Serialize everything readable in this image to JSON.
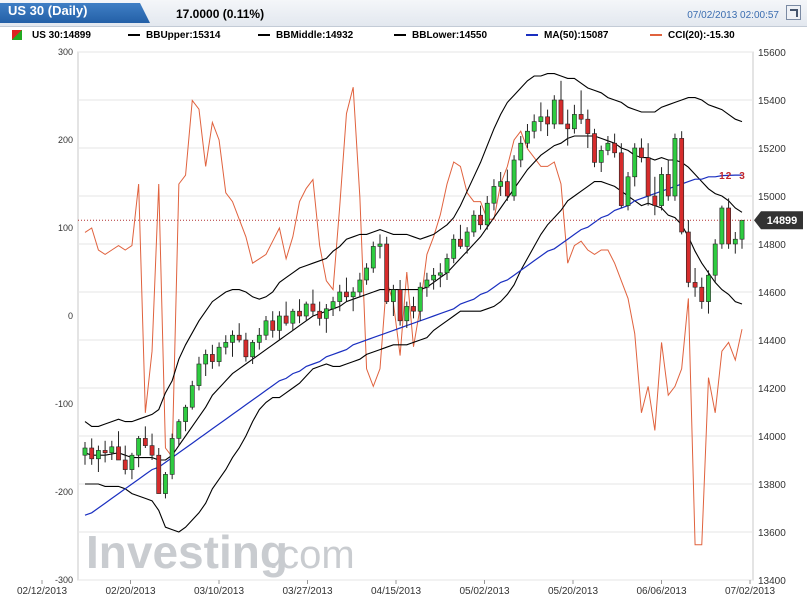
{
  "header": {
    "title": "US 30 (Daily)",
    "change": "17.0000 (0.11%)",
    "timestamp": "07/02/2013 02:00:57"
  },
  "legend": {
    "symbol": "US 30:14899",
    "bb_upper": "BBUpper:15314",
    "bb_middle": "BBMiddle:14932",
    "bb_lower": "BBLower:14550",
    "ma": "MA(50):15087",
    "cci": "CCI(20):-15.30"
  },
  "colors": {
    "up": "#2ecc40",
    "down": "#d62c2c",
    "bands": "#000000",
    "ma": "#1a2fc0",
    "cci": "#e0623e",
    "grid": "#e6e6e6"
  },
  "watermark": {
    "brand": "Investing",
    "suffix": ".com"
  },
  "chart_data": {
    "type": "candlestick",
    "price_axis": {
      "ticks": [
        13400,
        13600,
        13800,
        14000,
        14200,
        14400,
        14600,
        14800,
        15000,
        15200,
        15400,
        15600
      ],
      "ylim": [
        13400,
        15600
      ]
    },
    "cci_axis": {
      "ticks": [
        -300,
        -200,
        -100,
        0,
        100,
        200,
        300
      ],
      "ylim": [
        -300,
        300
      ]
    },
    "x_ticks": [
      "02/12/2013",
      "02/20/2013",
      "03/10/2013",
      "03/27/2013",
      "04/15/2013",
      "05/02/2013",
      "05/20/2013",
      "06/06/2013",
      "07/02/2013"
    ],
    "last_price": 14899,
    "markers": [
      "1",
      "2",
      "3"
    ],
    "candles": [
      [
        13920,
        13975,
        13880,
        13950
      ],
      [
        13950,
        13990,
        13880,
        13905
      ],
      [
        13905,
        13960,
        13850,
        13940
      ],
      [
        13940,
        13980,
        13890,
        13930
      ],
      [
        13930,
        13980,
        13900,
        13955
      ],
      [
        13955,
        14020,
        13900,
        13900
      ],
      [
        13900,
        13960,
        13840,
        13860
      ],
      [
        13860,
        13930,
        13820,
        13920
      ],
      [
        13920,
        14000,
        13870,
        13990
      ],
      [
        13990,
        14040,
        13950,
        13960
      ],
      [
        13960,
        14010,
        13900,
        13920
      ],
      [
        13920,
        13950,
        13760,
        13760
      ],
      [
        13760,
        13850,
        13740,
        13840
      ],
      [
        13840,
        14010,
        13820,
        13990
      ],
      [
        13990,
        14070,
        13960,
        14060
      ],
      [
        14060,
        14130,
        14020,
        14120
      ],
      [
        14120,
        14230,
        14110,
        14210
      ],
      [
        14210,
        14330,
        14190,
        14300
      ],
      [
        14300,
        14360,
        14250,
        14340
      ],
      [
        14340,
        14380,
        14280,
        14310
      ],
      [
        14310,
        14390,
        14290,
        14370
      ],
      [
        14370,
        14420,
        14340,
        14390
      ],
      [
        14390,
        14440,
        14330,
        14420
      ],
      [
        14420,
        14470,
        14390,
        14400
      ],
      [
        14400,
        14430,
        14310,
        14330
      ],
      [
        14330,
        14400,
        14300,
        14390
      ],
      [
        14390,
        14450,
        14360,
        14420
      ],
      [
        14420,
        14500,
        14400,
        14480
      ],
      [
        14480,
        14520,
        14410,
        14440
      ],
      [
        14440,
        14520,
        14400,
        14500
      ],
      [
        14500,
        14560,
        14460,
        14470
      ],
      [
        14470,
        14530,
        14440,
        14520
      ],
      [
        14520,
        14570,
        14470,
        14500
      ],
      [
        14500,
        14560,
        14480,
        14550
      ],
      [
        14550,
        14610,
        14500,
        14520
      ],
      [
        14520,
        14560,
        14460,
        14490
      ],
      [
        14490,
        14550,
        14430,
        14530
      ],
      [
        14530,
        14580,
        14500,
        14560
      ],
      [
        14560,
        14630,
        14520,
        14600
      ],
      [
        14600,
        14660,
        14560,
        14580
      ],
      [
        14580,
        14620,
        14520,
        14600
      ],
      [
        14600,
        14680,
        14580,
        14650
      ],
      [
        14650,
        14720,
        14630,
        14700
      ],
      [
        14700,
        14810,
        14680,
        14790
      ],
      [
        14790,
        14840,
        14740,
        14800
      ],
      [
        14800,
        14830,
        14550,
        14560
      ],
      [
        14560,
        14630,
        14500,
        14610
      ],
      [
        14610,
        14650,
        14460,
        14480
      ],
      [
        14480,
        14560,
        14450,
        14540
      ],
      [
        14540,
        14580,
        14490,
        14520
      ],
      [
        14520,
        14640,
        14480,
        14620
      ],
      [
        14620,
        14680,
        14580,
        14650
      ],
      [
        14650,
        14700,
        14610,
        14670
      ],
      [
        14670,
        14720,
        14620,
        14680
      ],
      [
        14680,
        14760,
        14650,
        14740
      ],
      [
        14740,
        14840,
        14720,
        14820
      ],
      [
        14820,
        14880,
        14780,
        14790
      ],
      [
        14790,
        14870,
        14760,
        14850
      ],
      [
        14850,
        14940,
        14830,
        14920
      ],
      [
        14920,
        14960,
        14860,
        14880
      ],
      [
        14880,
        15000,
        14860,
        14970
      ],
      [
        14970,
        15070,
        14940,
        15040
      ],
      [
        15040,
        15100,
        15000,
        15060
      ],
      [
        15060,
        15110,
        14980,
        15000
      ],
      [
        15000,
        15170,
        14980,
        15150
      ],
      [
        15150,
        15250,
        15120,
        15220
      ],
      [
        15220,
        15300,
        15200,
        15270
      ],
      [
        15270,
        15340,
        15240,
        15310
      ],
      [
        15310,
        15390,
        15270,
        15330
      ],
      [
        15330,
        15360,
        15250,
        15300
      ],
      [
        15300,
        15420,
        15280,
        15400
      ],
      [
        15400,
        15480,
        15360,
        15300
      ],
      [
        15300,
        15360,
        15210,
        15280
      ],
      [
        15280,
        15380,
        15260,
        15340
      ],
      [
        15340,
        15440,
        15300,
        15320
      ],
      [
        15320,
        15360,
        15200,
        15260
      ],
      [
        15260,
        15280,
        15120,
        15140
      ],
      [
        15140,
        15210,
        15100,
        15190
      ],
      [
        15190,
        15250,
        15170,
        15220
      ],
      [
        15220,
        15260,
        15160,
        15180
      ],
      [
        15180,
        15220,
        14950,
        14960
      ],
      [
        14960,
        15100,
        14940,
        15080
      ],
      [
        15080,
        15220,
        15040,
        15200
      ],
      [
        15200,
        15240,
        15140,
        15160
      ],
      [
        15160,
        15220,
        14960,
        15000
      ],
      [
        15000,
        15080,
        14920,
        14960
      ],
      [
        14960,
        15120,
        14940,
        15090
      ],
      [
        15090,
        15150,
        14980,
        15000
      ],
      [
        15000,
        15260,
        14980,
        15240
      ],
      [
        15240,
        15270,
        14840,
        14850
      ],
      [
        14850,
        14900,
        14620,
        14640
      ],
      [
        14640,
        14700,
        14580,
        14620
      ],
      [
        14620,
        14660,
        14530,
        14560
      ],
      [
        14560,
        14690,
        14510,
        14670
      ],
      [
        14670,
        14820,
        14640,
        14800
      ],
      [
        14800,
        14960,
        14780,
        14950
      ],
      [
        14950,
        14990,
        14780,
        14800
      ],
      [
        14800,
        14850,
        14760,
        14820
      ],
      [
        14820,
        14900,
        14780,
        14899
      ]
    ],
    "bb_upper": [
      14060,
      14040,
      14040,
      14050,
      14060,
      14070,
      14060,
      14060,
      14070,
      14080,
      14090,
      14110,
      14180,
      14230,
      14320,
      14380,
      14430,
      14480,
      14520,
      14560,
      14580,
      14600,
      14610,
      14610,
      14600,
      14580,
      14570,
      14580,
      14600,
      14640,
      14660,
      14680,
      14700,
      14710,
      14720,
      14730,
      14740,
      14770,
      14790,
      14820,
      14830,
      14840,
      14840,
      14850,
      14860,
      14850,
      14840,
      14840,
      14840,
      14830,
      14820,
      14830,
      14840,
      14860,
      14880,
      14910,
      14960,
      15020,
      15080,
      15140,
      15210,
      15280,
      15340,
      15390,
      15420,
      15450,
      15480,
      15500,
      15500,
      15510,
      15510,
      15500,
      15490,
      15490,
      15470,
      15450,
      15440,
      15430,
      15410,
      15400,
      15390,
      15370,
      15360,
      15350,
      15350,
      15350,
      15370,
      15380,
      15390,
      15400,
      15410,
      15410,
      15400,
      15380,
      15370,
      15360,
      15340,
      15320,
      15310
    ],
    "bb_middle": [
      13930,
      13920,
      13920,
      13920,
      13925,
      13930,
      13920,
      13910,
      13910,
      13910,
      13910,
      13900,
      13900,
      13920,
      13960,
      14000,
      14040,
      14080,
      14120,
      14170,
      14200,
      14230,
      14260,
      14280,
      14300,
      14320,
      14340,
      14360,
      14380,
      14400,
      14420,
      14440,
      14460,
      14480,
      14500,
      14510,
      14520,
      14530,
      14540,
      14560,
      14570,
      14580,
      14590,
      14600,
      14610,
      14610,
      14610,
      14610,
      14610,
      14610,
      14610,
      14620,
      14640,
      14660,
      14680,
      14710,
      14740,
      14770,
      14800,
      14830,
      14870,
      14910,
      14950,
      14990,
      15030,
      15070,
      15110,
      15140,
      15170,
      15190,
      15210,
      15220,
      15240,
      15250,
      15250,
      15250,
      15250,
      15240,
      15230,
      15220,
      15200,
      15190,
      15170,
      15160,
      15160,
      15150,
      15160,
      15150,
      15150,
      15140,
      15120,
      15090,
      15060,
      15030,
      15010,
      15000,
      14980,
      14950,
      14932
    ],
    "bb_lower": [
      13800,
      13800,
      13800,
      13790,
      13790,
      13790,
      13780,
      13760,
      13750,
      13740,
      13730,
      13690,
      13620,
      13610,
      13600,
      13620,
      13650,
      13680,
      13720,
      13780,
      13820,
      13860,
      13910,
      13950,
      14000,
      14060,
      14110,
      14140,
      14160,
      14160,
      14180,
      14200,
      14220,
      14250,
      14280,
      14290,
      14300,
      14290,
      14290,
      14300,
      14310,
      14320,
      14340,
      14350,
      14360,
      14370,
      14380,
      14380,
      14380,
      14390,
      14400,
      14410,
      14440,
      14460,
      14480,
      14500,
      14520,
      14520,
      14520,
      14520,
      14530,
      14540,
      14560,
      14590,
      14630,
      14690,
      14740,
      14790,
      14840,
      14880,
      14910,
      14940,
      14980,
      15000,
      15020,
      15040,
      15060,
      15060,
      15050,
      15040,
      15020,
      15000,
      14980,
      14960,
      14970,
      14960,
      14950,
      14920,
      14910,
      14880,
      14830,
      14770,
      14720,
      14680,
      14640,
      14610,
      14590,
      14560,
      14550
    ],
    "ma50": [
      13670,
      13680,
      13700,
      13720,
      13740,
      13760,
      13780,
      13800,
      13820,
      13840,
      13860,
      13870,
      13890,
      13910,
      13930,
      13950,
      13970,
      13990,
      14010,
      14030,
      14050,
      14070,
      14090,
      14110,
      14130,
      14150,
      14170,
      14190,
      14210,
      14230,
      14240,
      14260,
      14270,
      14290,
      14300,
      14310,
      14330,
      14340,
      14350,
      14360,
      14380,
      14390,
      14400,
      14410,
      14420,
      14430,
      14440,
      14450,
      14460,
      14470,
      14480,
      14490,
      14500,
      14510,
      14520,
      14530,
      14550,
      14560,
      14570,
      14590,
      14600,
      14620,
      14640,
      14650,
      14670,
      14690,
      14710,
      14730,
      14750,
      14770,
      14780,
      14800,
      14820,
      14840,
      14860,
      14870,
      14890,
      14910,
      14920,
      14940,
      14950,
      14960,
      14980,
      14990,
      15000,
      15010,
      15020,
      15030,
      15040,
      15050,
      15060,
      15070,
      15070,
      15080,
      15080,
      15085,
      15086,
      15087,
      15087
    ],
    "cci": [
      95,
      100,
      75,
      70,
      75,
      80,
      75,
      80,
      150,
      -110,
      -40,
      150,
      -150,
      -160,
      150,
      160,
      245,
      235,
      170,
      220,
      200,
      140,
      130,
      110,
      90,
      60,
      65,
      70,
      85,
      100,
      65,
      90,
      130,
      145,
      155,
      80,
      40,
      30,
      125,
      230,
      260,
      135,
      -60,
      -80,
      -60,
      40,
      15,
      -45,
      50,
      -35,
      10,
      70,
      90,
      115,
      150,
      175,
      170,
      140,
      130,
      130,
      110,
      110,
      150,
      170,
      200,
      210,
      190,
      180,
      170,
      170,
      175,
      150,
      60,
      80,
      85,
      75,
      70,
      75,
      75,
      60,
      40,
      20,
      -20,
      -110,
      -80,
      -130,
      -30,
      -90,
      -80,
      -60,
      20,
      -260,
      -260,
      -70,
      -110,
      -40,
      -30,
      -50,
      -15
    ]
  }
}
